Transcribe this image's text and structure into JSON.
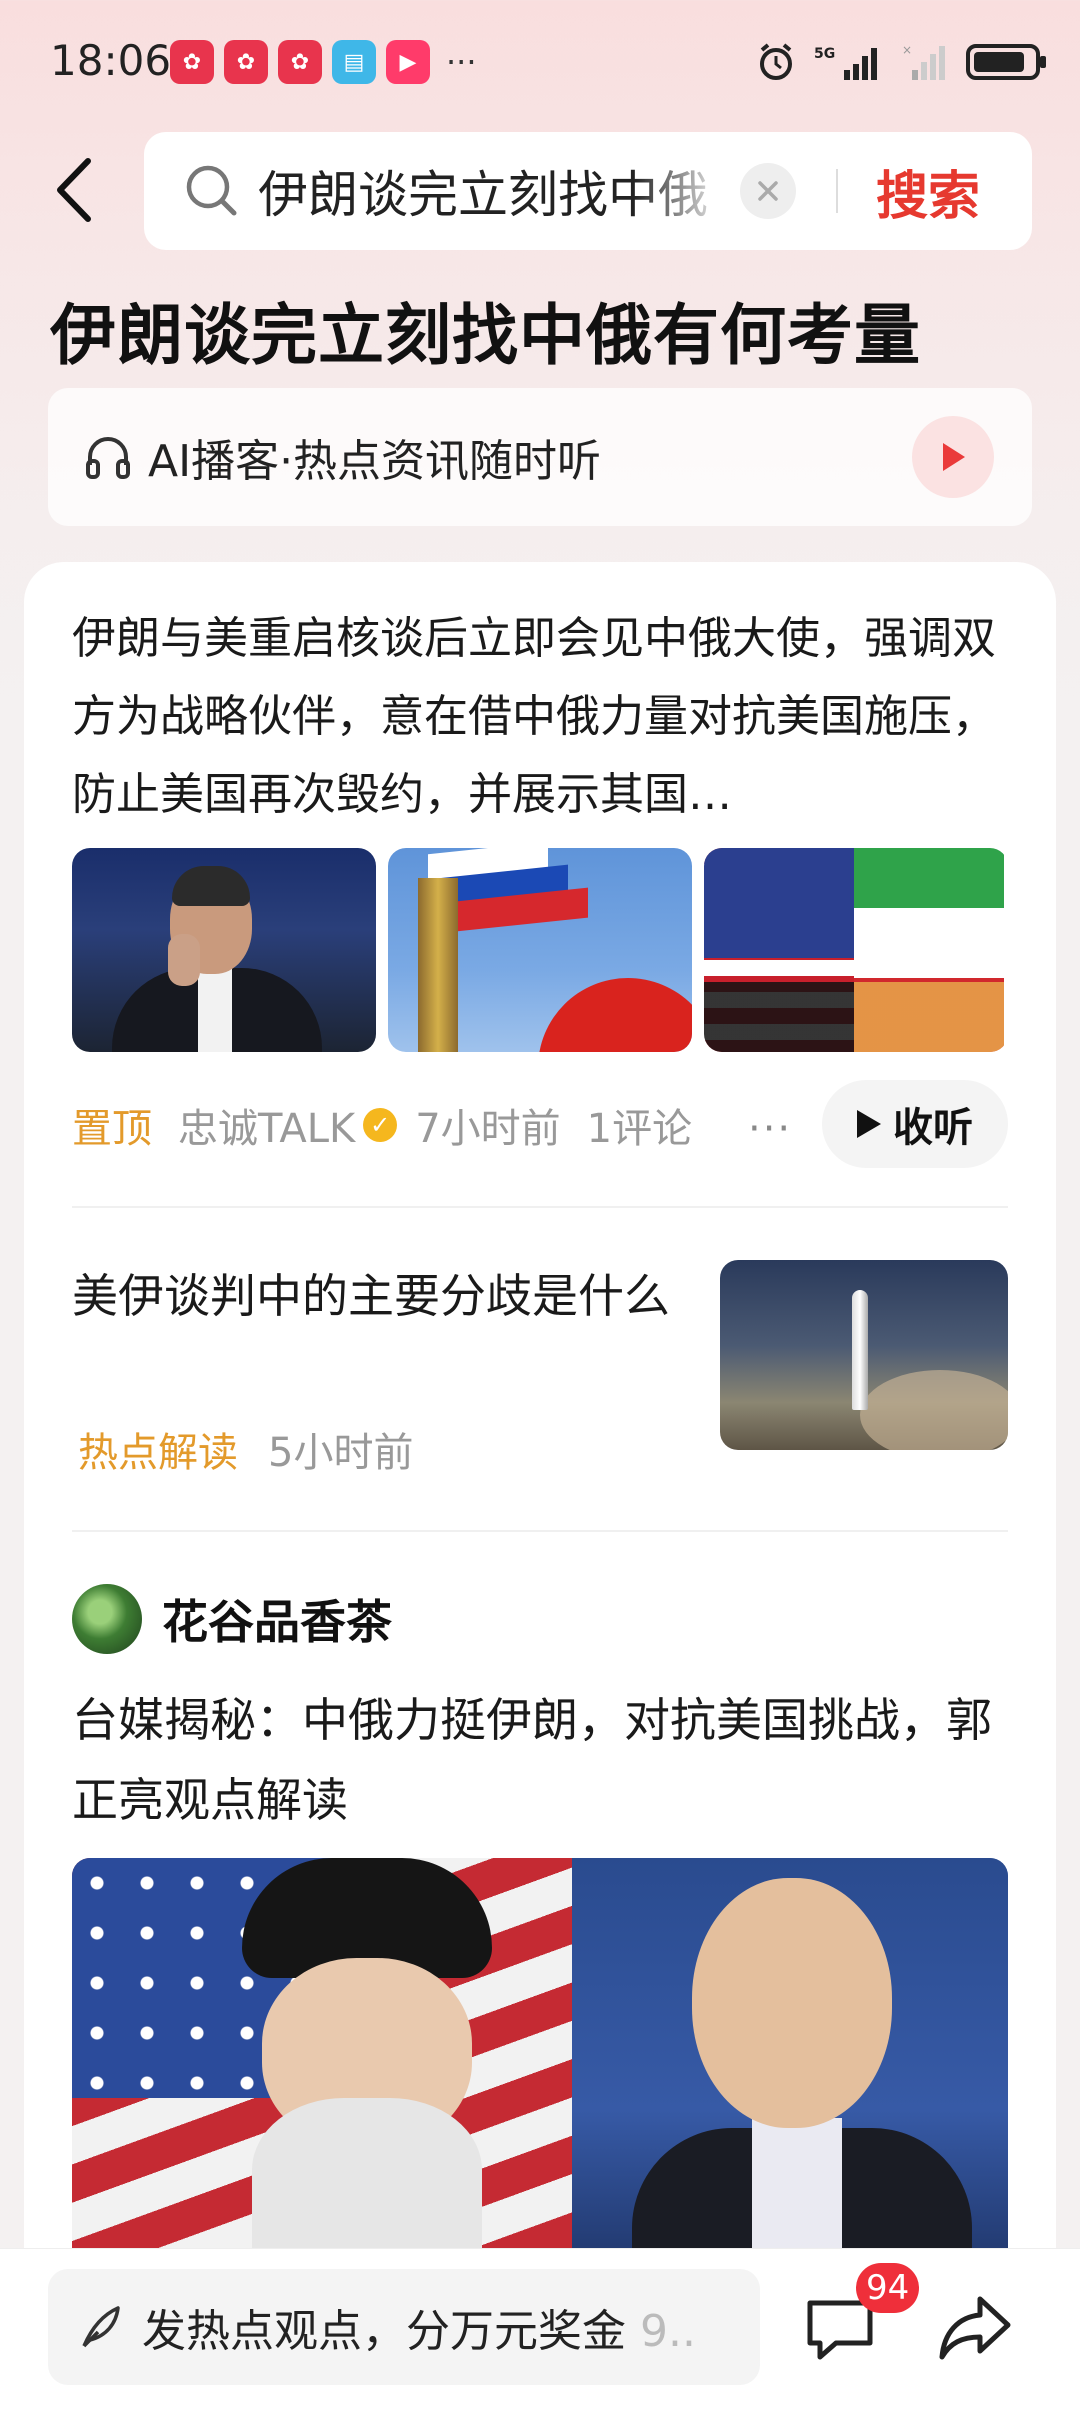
{
  "status_bar": {
    "time": "18:06",
    "app_icons": [
      "pinduoduo-icon",
      "pinduoduo-icon",
      "pinduoduo-icon",
      "book-icon",
      "video-icon"
    ],
    "more": "···",
    "network": "5G",
    "battery_level": 0.76
  },
  "search": {
    "query": "伊朗谈完立刻找中俄",
    "button_label": "搜索"
  },
  "page_title": "伊朗谈完立刻找中俄有何考量",
  "ai_bar": {
    "label": "AI播客·热点资讯随时听"
  },
  "article1": {
    "text": "伊朗与美重启核谈后立即会见中俄大使，强调双方为战略伙伴，意在借中俄力量对抗美国施压，防止美国再次毁约，并展示其国…",
    "pinned": "置顶",
    "author": "忠诚TALK",
    "time": "7小时前",
    "comments": "1评论",
    "more": "···",
    "listen_label": "收听"
  },
  "article2": {
    "title": "美伊谈判中的主要分歧是什么",
    "tag": "热点解读",
    "time": "5小时前"
  },
  "article3": {
    "author": "花谷品香茶",
    "title": "台媒揭秘：中俄力挺伊朗，对抗美国挑战，郭正亮观点解读"
  },
  "bottom_bar": {
    "comment_placeholder": "发热点观点，分万元奖金",
    "comment_tail": "9..",
    "comment_count": "94"
  },
  "colors": {
    "accent_red": "#e6392f",
    "pinned_orange": "#e39a2b",
    "badge_red": "#ef2f3a"
  }
}
